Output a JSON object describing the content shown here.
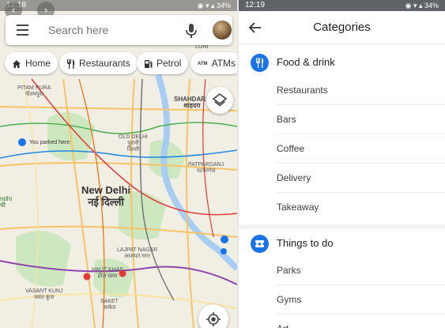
{
  "left": {
    "status": {
      "time": "12:18",
      "battery": "34%"
    },
    "search": {
      "placeholder": "Search here"
    },
    "chips": [
      {
        "label": "Home",
        "icon": "home-icon"
      },
      {
        "label": "Restaurants",
        "icon": "cutlery-icon"
      },
      {
        "label": "Petrol",
        "icon": "fuel-icon"
      },
      {
        "label": "ATMs",
        "icon": "atm-icon"
      }
    ],
    "map": {
      "labels": {
        "loni": "LONI",
        "pitampura": "PITAM PURA\nपीतमपुरा",
        "shahdara": "SHAHDARA\nशाहदरा",
        "old_delhi": "OLD DELHI\nपुरानी\nदिल्ली",
        "parked": "You parked here",
        "patparganj": "PATPARGANJ\nपटपरगंज",
        "new_delhi": "New Delhi\nनई दिल्ली",
        "lajpat": "LAJPAT NAGAR\nलाजपत नगर",
        "hauz_khas": "HAUZ KHAS\nहौज़ खास",
        "vasant_kunj": "VASANT KUNJ\nवसंत कुंज",
        "saket": "SAKET\nसाकेत",
        "ndhi": "ndhi\nधी"
      }
    }
  },
  "right": {
    "status": {
      "time": "12:19",
      "battery": "34%"
    },
    "title": "Categories",
    "sections": [
      {
        "label": "Food & drink",
        "icon": "cutlery-icon",
        "items": [
          "Restaurants",
          "Bars",
          "Coffee",
          "Delivery",
          "Takeaway"
        ]
      },
      {
        "label": "Things to do",
        "icon": "ticket-icon",
        "items": [
          "Parks",
          "Gyms",
          "Art"
        ]
      }
    ]
  },
  "colors": {
    "accent": "#1a73e8",
    "map_bg": "#f1eee4",
    "road_major": "#f6c466"
  }
}
